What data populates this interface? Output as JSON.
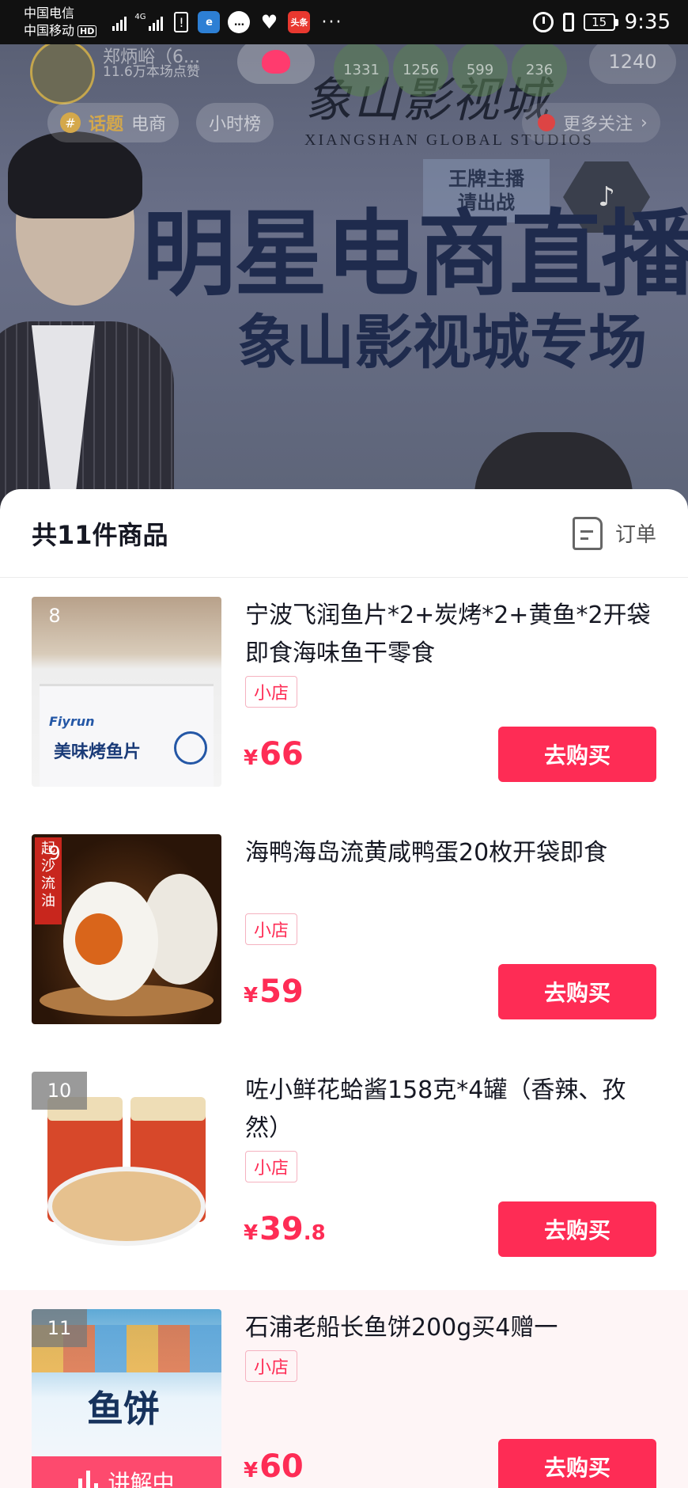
{
  "status_bar": {
    "carrier1": "中国电信",
    "carrier2": "中国移动",
    "hd": "HD",
    "net": "4G",
    "battery": "15",
    "time": "9:35",
    "news_badge": "头条",
    "dots": "···"
  },
  "live": {
    "anchor_name": "郑炳峪（6...",
    "anchor_sub": "11.6万本场点赞",
    "viewers": [
      "1331",
      "1256",
      "599",
      "236"
    ],
    "online_count": "1240",
    "tag_topic": "话题",
    "tag_topic_text": "电商",
    "tag_hourly": "小时榜",
    "more_follow": "更多关注",
    "studio_logo": "象山影视城",
    "studio_en": "XIANGSHAN GLOBAL STUDIOS",
    "ace_line1": "王牌主播",
    "ace_line2": "请出战",
    "headline": "明星电商直播",
    "subline": "象山影视城专场"
  },
  "sheet": {
    "title": "共11件商品",
    "orders_label": "订单"
  },
  "products": [
    {
      "index": "8",
      "name": "宁波飞润鱼片*2+炭烤*2+黄鱼*2开袋即食海味鱼干零食",
      "tag": "小店",
      "currency": "¥",
      "price": "66",
      "price_dec": "",
      "buy": "去购买",
      "thumb_brand": "Fiyrun",
      "thumb_label": "美味烤鱼片"
    },
    {
      "index": "9",
      "name": "海鸭海岛流黄咸鸭蛋20枚开袋即食",
      "tag": "小店",
      "currency": "¥",
      "price": "59",
      "price_dec": "",
      "buy": "去购买",
      "thumb_side": "起沙流油"
    },
    {
      "index": "10",
      "name": "咗小鲜花蛤酱158克*4罐（香辣、孜然）",
      "tag": "小店",
      "currency": "¥",
      "price": "39",
      "price_dec": ".8",
      "buy": "去购买"
    },
    {
      "index": "11",
      "name": "石浦老船长鱼饼200g买4赠一",
      "tag": "小店",
      "currency": "¥",
      "price": "60",
      "price_dec": "",
      "buy": "去购买",
      "thumb_label": "鱼饼",
      "live_label": "讲解中"
    }
  ]
}
